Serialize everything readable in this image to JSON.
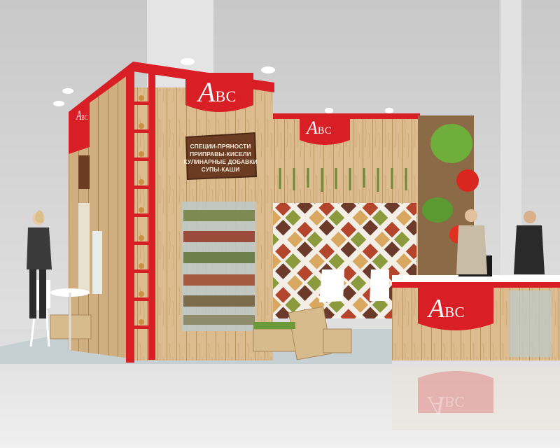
{
  "brand": {
    "logo_main": "A",
    "logo_sub": "BC"
  },
  "signboard": {
    "lines": [
      "СПЕЦИИ-ПРЯНОСТИ",
      "ПРИПРАВЫ-КИСЕЛИ",
      "КУЛИНАРНЫЕ ДОБАВКИ",
      "СУПЫ-КАШИ"
    ]
  },
  "colors": {
    "brand_red": "#d91f26",
    "wood": "#d9b98a",
    "floor": "#e6e6e6",
    "background": "#cfcfcf"
  }
}
